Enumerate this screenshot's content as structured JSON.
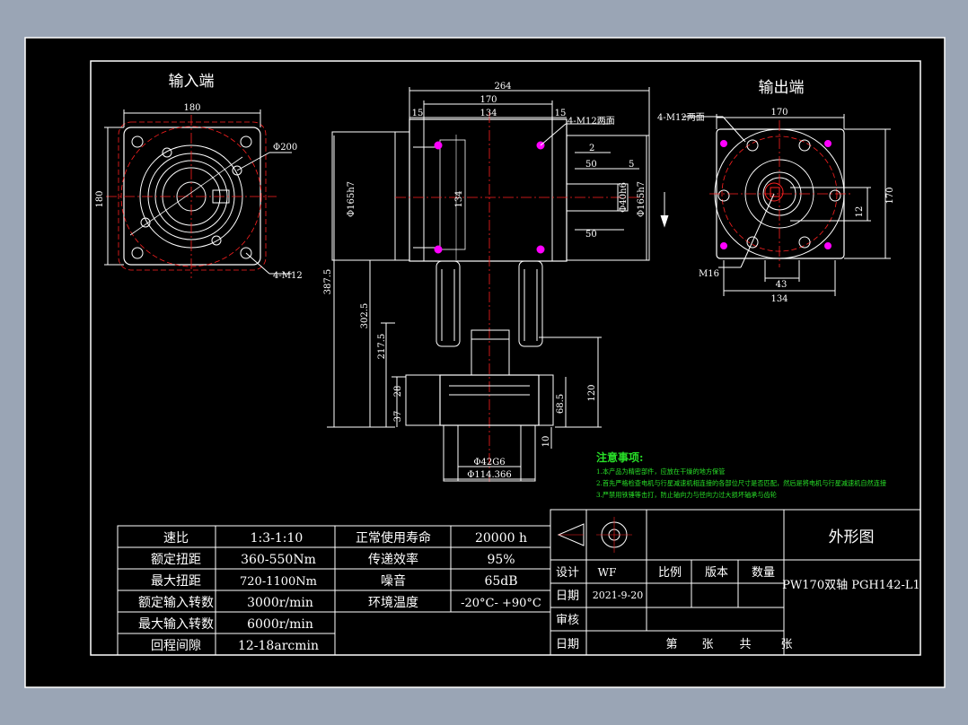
{
  "views": {
    "input_end": "输入端",
    "output_end": "输出端"
  },
  "dimensions": {
    "in_180_top": "180",
    "in_180_side": "180",
    "in_phi200": "Φ200",
    "in_4m12": "4-M12",
    "mid_264": "264",
    "mid_170": "170",
    "mid_134": "134",
    "mid_15_left": "15",
    "mid_15_right": "15",
    "mid_4m12_both": "4-M12两面",
    "mid_2": "2",
    "mid_50_top": "50",
    "mid_5": "5",
    "mid_50_bottom": "50",
    "mid_134_v": "134",
    "mid_phi165_left": "Φ165h7",
    "mid_phi165_right": "Φ165h7",
    "mid_phi40": "Φ40h6",
    "mid_387": "387.5",
    "mid_302": "302.5",
    "mid_217": "217.5",
    "mid_28": "28",
    "mid_37": "37",
    "mid_120": "120",
    "mid_68": "68.5",
    "mid_10": "10",
    "mid_phi42": "Φ42G6",
    "mid_phi114": "Φ114.366",
    "out_4m12_both": "4-M12两面",
    "out_170_top": "170",
    "out_12": "12",
    "out_170_side": "170",
    "out_m16": "M16",
    "out_43": "43",
    "out_134": "134"
  },
  "notes": {
    "title": "注意事项:",
    "items": [
      "1.本产品为精密部件，应放在干燥的地方保管",
      "2.首先严格检查电机与行星减速机相连接的各部位尺寸是否匹配，然后是将电机与行星减速机自然连接",
      "3.严禁用铁锤等击打，防止轴向力与径向力过大损坏轴承与齿轮"
    ]
  },
  "spec_table": {
    "rows": [
      {
        "k1": "速比",
        "v1": "1:3-1:10",
        "k2": "正常使用寿命",
        "v2": "20000 h"
      },
      {
        "k1": "额定扭距",
        "v1": "360-550Nm",
        "k2": "传递效率",
        "v2": "95%"
      },
      {
        "k1": "最大扭距",
        "v1": "720-1100Nm",
        "k2": "噪音",
        "v2": "65dB"
      },
      {
        "k1": "额定输入转数",
        "v1": "3000r/min",
        "k2": "环境温度",
        "v2": "-20°C- +90°C"
      },
      {
        "k1": "最大输入转数",
        "v1": "6000r/min",
        "k2": "",
        "v2": ""
      },
      {
        "k1": "回程间隙",
        "v1": "12-18arcmin",
        "k2": "",
        "v2": ""
      }
    ]
  },
  "title_block": {
    "drawing_name": "外形图",
    "model": "PW170双轴 PGH142-L1",
    "design_label": "设计",
    "designer": "WF",
    "scale_label": "比例",
    "version_label": "版本",
    "qty_label": "数量",
    "date_label": "日期",
    "date": "2021-9-20",
    "review_label": "审核",
    "date2_label": "日期",
    "sheet_no": "第",
    "sheet_unit": "张",
    "sheet_total": "共",
    "sheet_unit2": "张"
  },
  "colors": {
    "background": "#9aa5b5",
    "sheet": "#000000",
    "line": "#ffffff",
    "centerline": "#ff2020",
    "notes": "#28e028",
    "bolt": "#ff00ff"
  }
}
